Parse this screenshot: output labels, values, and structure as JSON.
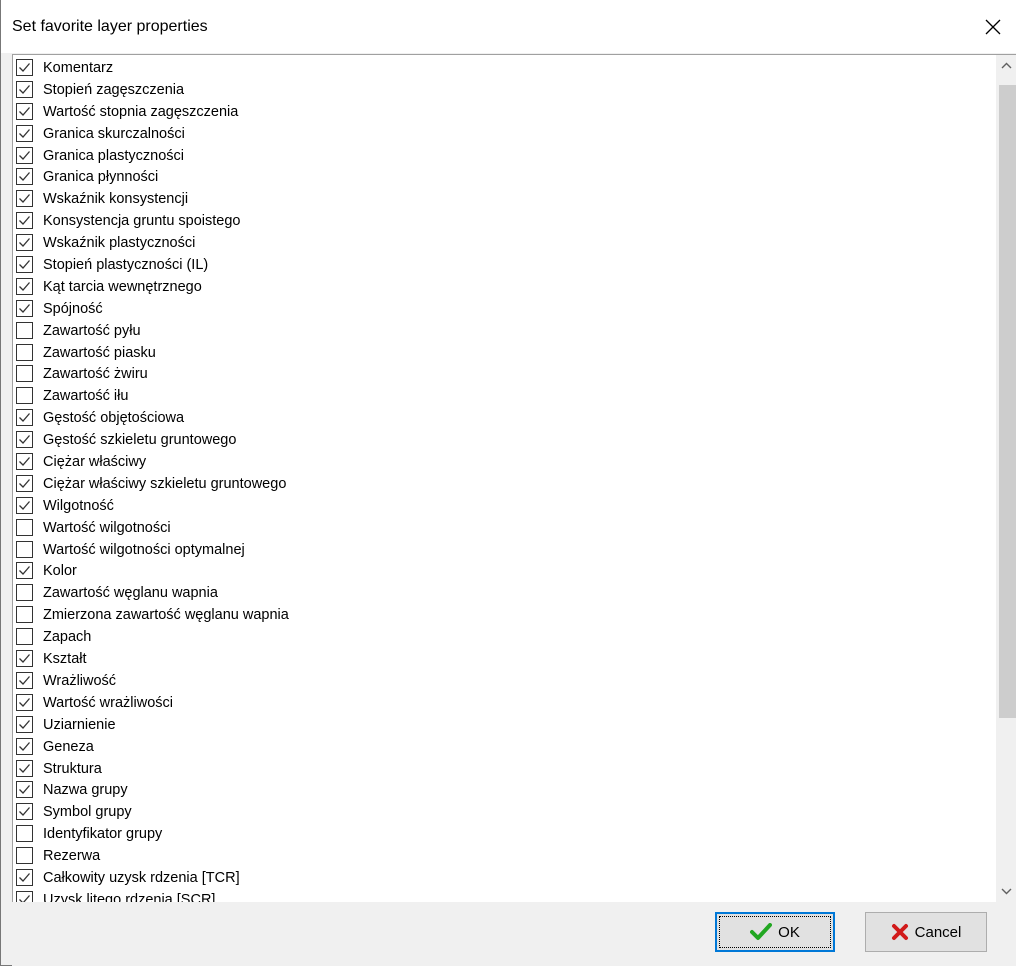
{
  "window": {
    "title": "Set favorite layer properties"
  },
  "items": [
    {
      "label": "Komentarz",
      "checked": true
    },
    {
      "label": "Stopień zagęszczenia",
      "checked": true
    },
    {
      "label": "Wartość stopnia zagęszczenia",
      "checked": true
    },
    {
      "label": "Granica skurczalności",
      "checked": true
    },
    {
      "label": "Granica plastyczności",
      "checked": true
    },
    {
      "label": "Granica płynności",
      "checked": true
    },
    {
      "label": "Wskaźnik konsystencji",
      "checked": true
    },
    {
      "label": "Konsystencja gruntu spoistego",
      "checked": true
    },
    {
      "label": "Wskaźnik plastyczności",
      "checked": true
    },
    {
      "label": "Stopień plastyczności (IL)",
      "checked": true
    },
    {
      "label": "Kąt tarcia wewnętrznego",
      "checked": true
    },
    {
      "label": "Spójność",
      "checked": true
    },
    {
      "label": "Zawartość pyłu",
      "checked": false
    },
    {
      "label": "Zawartość piasku",
      "checked": false
    },
    {
      "label": "Zawartość żwiru",
      "checked": false
    },
    {
      "label": "Zawartość iłu",
      "checked": false
    },
    {
      "label": "Gęstość objętościowa",
      "checked": true
    },
    {
      "label": "Gęstość szkieletu gruntowego",
      "checked": true
    },
    {
      "label": "Ciężar właściwy",
      "checked": true
    },
    {
      "label": "Ciężar właściwy szkieletu gruntowego",
      "checked": true
    },
    {
      "label": "Wilgotność",
      "checked": true
    },
    {
      "label": "Wartość wilgotności",
      "checked": false
    },
    {
      "label": "Wartość wilgotności optymalnej",
      "checked": false
    },
    {
      "label": "Kolor",
      "checked": true
    },
    {
      "label": "Zawartość węglanu wapnia",
      "checked": false
    },
    {
      "label": "Zmierzona zawartość węglanu wapnia",
      "checked": false
    },
    {
      "label": "Zapach",
      "checked": false
    },
    {
      "label": "Kształt",
      "checked": true
    },
    {
      "label": "Wrażliwość",
      "checked": true
    },
    {
      "label": "Wartość wrażliwości",
      "checked": true
    },
    {
      "label": "Uziarnienie",
      "checked": true
    },
    {
      "label": "Geneza",
      "checked": true
    },
    {
      "label": "Struktura",
      "checked": true
    },
    {
      "label": "Nazwa grupy",
      "checked": true
    },
    {
      "label": "Symbol grupy",
      "checked": true
    },
    {
      "label": "Identyfikator grupy",
      "checked": false
    },
    {
      "label": "Rezerwa",
      "checked": false
    },
    {
      "label": "Całkowity uzysk rdzenia [TCR]",
      "checked": true
    },
    {
      "label": "Uzysk litego rdzenia [SCR]",
      "checked": true
    }
  ],
  "buttons": {
    "ok_label": "OK",
    "cancel_label": "Cancel"
  },
  "icons": {
    "close": "close-icon",
    "check": "checkmark-icon",
    "ok": "green-check-icon",
    "cancel": "red-x-icon",
    "scroll_up": "chevron-up-icon",
    "scroll_down": "chevron-down-icon"
  },
  "colors": {
    "ok_icon": "#22a722",
    "cancel_icon": "#d11a1a",
    "focus_border": "#0078d7"
  }
}
